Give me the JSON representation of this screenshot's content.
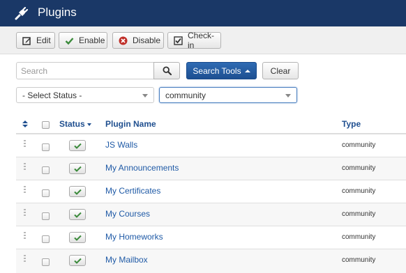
{
  "header": {
    "title": "Plugins",
    "icon": "plug-icon",
    "bg_color": "#1a3867"
  },
  "toolbar": {
    "edit_label": "Edit",
    "enable_label": "Enable",
    "disable_label": "Disable",
    "checkin_label": "Check-in"
  },
  "filters": {
    "search_placeholder": "Search",
    "search_value": "",
    "search_tools_label": "Search Tools",
    "clear_label": "Clear",
    "status_select": "- Select Status -",
    "type_select": "community"
  },
  "table": {
    "headers": {
      "status": "Status",
      "name": "Plugin Name",
      "type": "Type"
    },
    "rows": [
      {
        "name": "JS Walls",
        "type": "community",
        "enabled": true
      },
      {
        "name": "My Announcements",
        "type": "community",
        "enabled": true
      },
      {
        "name": "My Certificates",
        "type": "community",
        "enabled": true
      },
      {
        "name": "My Courses",
        "type": "community",
        "enabled": true
      },
      {
        "name": "My Homeworks",
        "type": "community",
        "enabled": true
      },
      {
        "name": "My Mailbox",
        "type": "community",
        "enabled": true
      }
    ]
  },
  "colors": {
    "accent": "#1f5aa6",
    "check": "#3a8a3a",
    "danger": "#c0302a"
  }
}
